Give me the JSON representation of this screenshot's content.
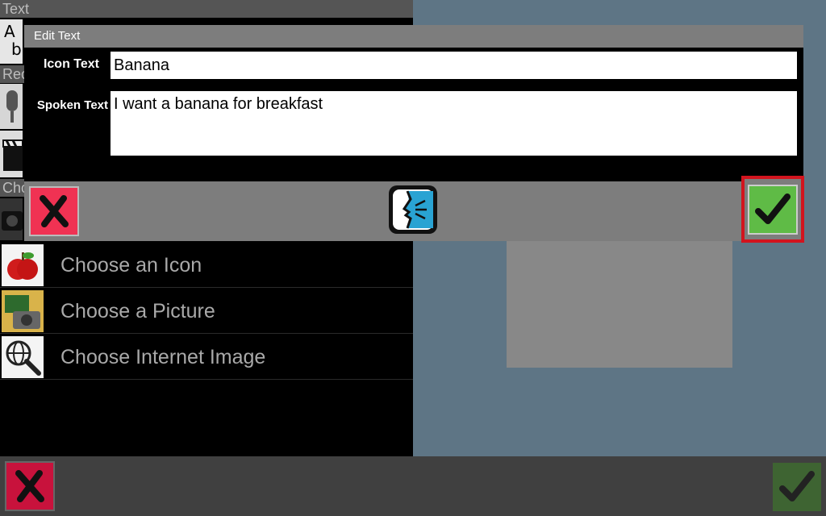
{
  "background_panel": {
    "section_text": "Text",
    "section_record": "Rec",
    "section_choose": "Cho",
    "menu_items": [
      {
        "label": "Choose an Icon",
        "icon": "apple-icon"
      },
      {
        "label": "Choose a Picture",
        "icon": "picture-camera-icon"
      },
      {
        "label": "Choose Internet Image",
        "icon": "globe-search-icon"
      }
    ]
  },
  "dialog": {
    "title": "Edit Text",
    "icon_text_label": "Icon Text",
    "icon_text_value": "Banana",
    "spoken_text_label": "Spoken Text",
    "spoken_text_value": "I want a banana for breakfast"
  },
  "colors": {
    "cancel_red": "#f03253",
    "ok_green": "#5fbb46",
    "highlight_red": "#d2141e",
    "speak_blue": "#29a3d3"
  }
}
